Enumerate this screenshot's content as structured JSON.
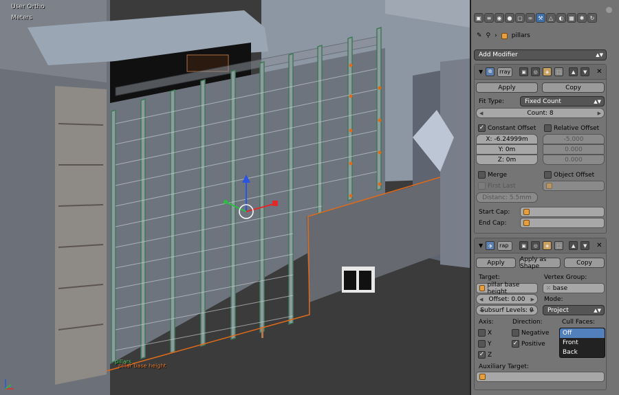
{
  "viewport": {
    "view_name": "User Ortho",
    "units": "Meters",
    "object_labels": [
      "pillars",
      "pillar base height"
    ]
  },
  "properties": {
    "active_tab_icon": "wrench-icon",
    "object_name": "pillars",
    "add_modifier_label": "Add Modifier"
  },
  "array_modifier": {
    "name": "rray",
    "apply_label": "Apply",
    "copy_label": "Copy",
    "fit_type_label": "Fit Type:",
    "fit_type_value": "Fixed Count",
    "count": "Count: 8",
    "constant_offset_label": "Constant Offset",
    "relative_offset_label": "Relative Offset",
    "const_x": "X: -6.24999m",
    "const_y": "Y: 0m",
    "const_z": "Z: 0m",
    "rel_x": "-5.000",
    "rel_y": "0.000",
    "rel_z": "0.000",
    "merge_label": "Merge",
    "object_offset_label": "Object Offset",
    "first_last_label": "First Last",
    "distance": "Distanc: 5.5mm",
    "start_cap_label": "Start Cap:",
    "end_cap_label": "End Cap:"
  },
  "shrinkwrap_modifier": {
    "name": "rap",
    "apply_label": "Apply",
    "apply_shape_label": "Apply as Shape",
    "copy_label": "Copy",
    "target_label": "Target:",
    "target_value": "pillar base height",
    "vertex_group_label": "Vertex Group:",
    "vertex_group_value": "base",
    "offset": "Offset: 0.00",
    "mode_label": "Mode:",
    "subsurf": "Subsurf Levels: 0",
    "mode_value": "Project",
    "axis_label": "Axis:",
    "direction_label": "Direction:",
    "cull_faces_label": "Cull Faces:",
    "axis_x": "X",
    "axis_y": "Y",
    "axis_z": "Z",
    "negative_label": "Negative",
    "positive_label": "Positive",
    "cull_options": [
      "Off",
      "Front",
      "Back"
    ],
    "auxiliary_target_label": "Auxiliary Target:"
  }
}
